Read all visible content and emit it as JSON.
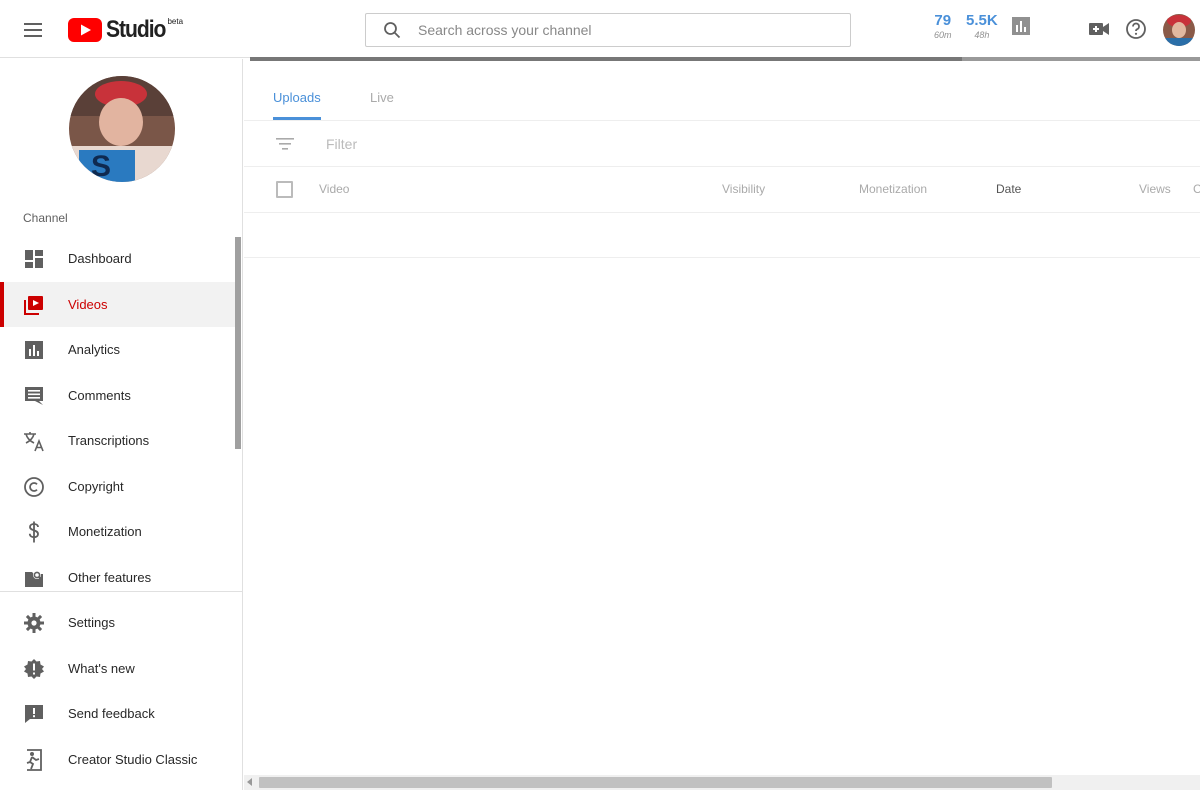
{
  "header": {
    "logo_text": "Studio",
    "logo_badge": "beta",
    "search_placeholder": "Search across your channel",
    "stats": [
      {
        "value": "79",
        "label": "60m"
      },
      {
        "value": "5.5K",
        "label": "48h"
      }
    ]
  },
  "sidebar": {
    "section_label": "Channel",
    "items": [
      {
        "label": "Dashboard",
        "icon": "dashboard-icon"
      },
      {
        "label": "Videos",
        "icon": "videos-icon",
        "active": true
      },
      {
        "label": "Analytics",
        "icon": "analytics-icon"
      },
      {
        "label": "Comments",
        "icon": "comments-icon"
      },
      {
        "label": "Transcriptions",
        "icon": "translate-icon"
      },
      {
        "label": "Copyright",
        "icon": "copyright-icon"
      },
      {
        "label": "Monetization",
        "icon": "dollar-icon"
      },
      {
        "label": "Other features",
        "icon": "other-features-icon"
      }
    ],
    "bottom_items": [
      {
        "label": "Settings",
        "icon": "gear-icon"
      },
      {
        "label": "What's new",
        "icon": "whats-new-icon"
      },
      {
        "label": "Send feedback",
        "icon": "feedback-icon"
      },
      {
        "label": "Creator Studio Classic",
        "icon": "exit-icon"
      }
    ]
  },
  "main": {
    "tabs": [
      {
        "label": "Uploads",
        "active": true
      },
      {
        "label": "Live",
        "active": false
      }
    ],
    "filter_placeholder": "Filter",
    "columns": [
      "Video",
      "Visibility",
      "Monetization",
      "Date",
      "Views",
      "C"
    ]
  },
  "colors": {
    "accent_blue": "#4a90d9",
    "active_red": "#cc0000",
    "youtube_red": "#ff0000"
  }
}
